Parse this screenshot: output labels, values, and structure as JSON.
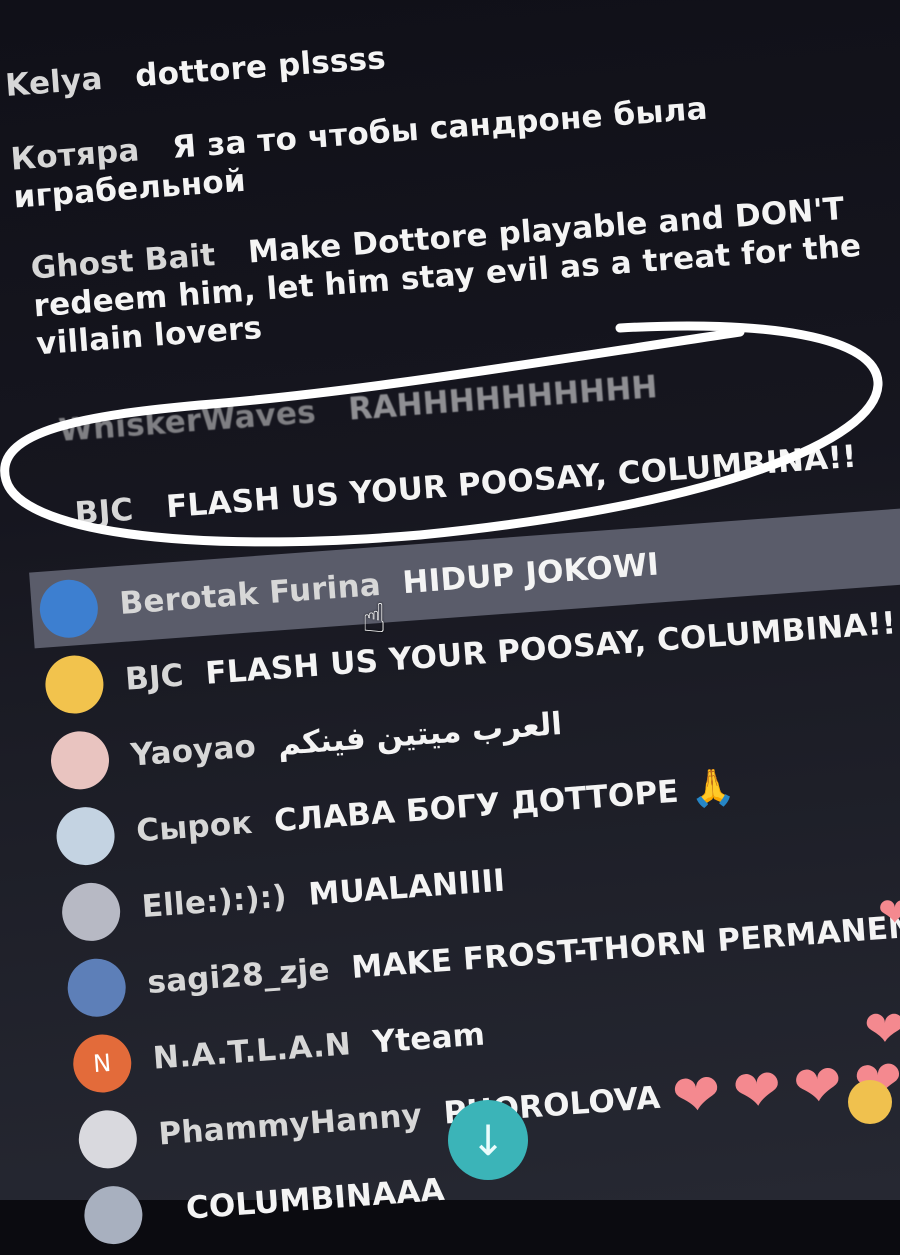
{
  "chat": {
    "messages": [
      {
        "user": "Kelya",
        "text": "dottore plssss"
      },
      {
        "user": "Котяра",
        "text": "Я за то чтобы сандроне была играбельной"
      },
      {
        "user": "Ghost Bait",
        "text": "Make Dottore playable and DON'T redeem him, let him stay evil as a treat for the villain lovers"
      },
      {
        "user": "WhiskerWaves",
        "text": "RAHHHHHHHHHH"
      },
      {
        "user": "BJC",
        "text": "FLASH US YOUR POOSAY, COLUMBINA!!"
      },
      {
        "user": "Berotak Furina",
        "text": "HIDUP JOKOWI"
      },
      {
        "user": "BJC",
        "text": "FLASH US YOUR POOSAY, COLUMBINA!!"
      },
      {
        "user": "Yaoyao",
        "text": "العرب ميتين فينكم"
      },
      {
        "user": "Сырок",
        "text": "СЛАВА БОГУ ДОТТОРЕ",
        "emoji": "🙏"
      },
      {
        "user": "Elle:):):)",
        "text": "MUALANIIII"
      },
      {
        "user": "sagi28_zje",
        "text": "MAKE FROST-THORN PERMANENT!!!!"
      },
      {
        "user": "N.A.T.L.A.N",
        "text": "Yteam",
        "avatar_letter": "N"
      },
      {
        "user": "PhammyHanny",
        "text": "PHOROLOVA"
      },
      {
        "user": "",
        "text": "COLUMBINAAA"
      }
    ]
  },
  "colors": {
    "background": "#16161f",
    "highlight_row": "#5a5c6a",
    "scroll_button": "#3bb4b8",
    "heart": "#f4898f",
    "annotation_circle": "#ffffff",
    "avatar_n": "#e36b3a"
  },
  "icons": {
    "scroll_down": "arrow-down-icon",
    "cursor": "hand-pointer-icon",
    "reaction": "heart-icon"
  }
}
